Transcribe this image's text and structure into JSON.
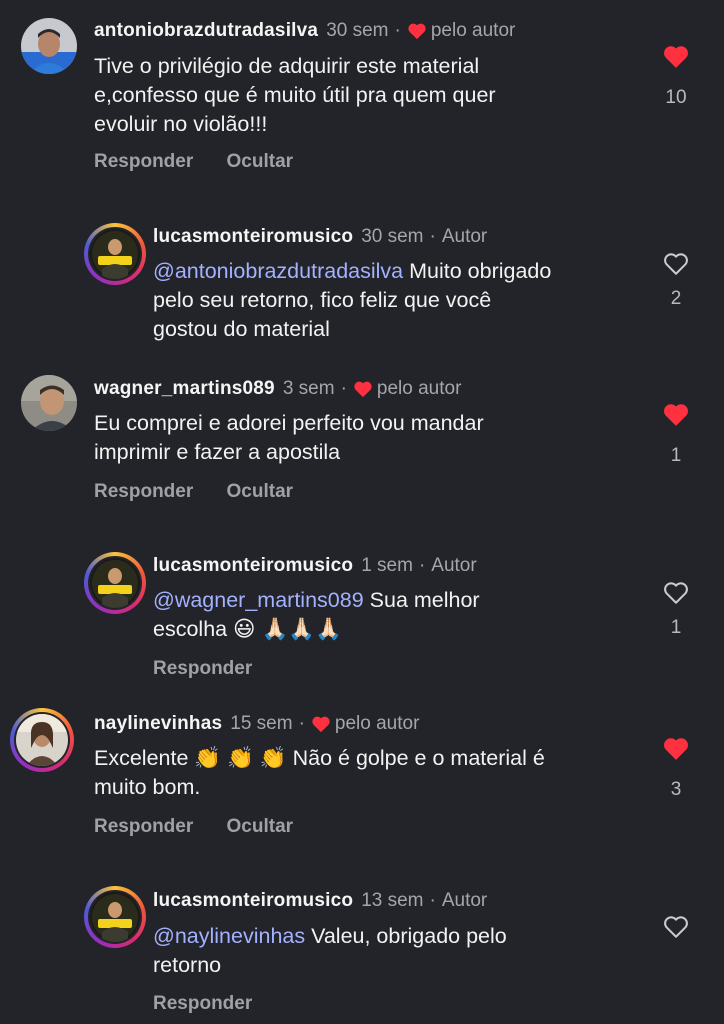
{
  "comments": [
    {
      "username": "antoniobrazdutradasilva",
      "time": "30 sem",
      "badge": "pelo autor",
      "text_lines": [
        "Tive o privilégio de adquirir este material",
        "e,confesso que é muito útil pra quem quer",
        "evoluir no violão!!!"
      ],
      "like_count": "10",
      "liked": true,
      "actions": [
        "Responder",
        "Ocultar"
      ]
    },
    {
      "username": "lucasmonteiromusico",
      "time": "30 sem",
      "badge": "Autor",
      "mention": "@antoniobrazdutradasilva",
      "text_lines": [
        "Muito obrigado",
        "pelo seu retorno, fico feliz que você",
        "gostou do material"
      ],
      "like_count": "2",
      "liked": false
    },
    {
      "username": "wagner_martins089",
      "time": "3 sem",
      "badge": "pelo autor",
      "text_lines": [
        "Eu comprei e adorei perfeito vou mandar",
        "imprimir e fazer a apostila"
      ],
      "like_count": "1",
      "liked": true,
      "actions": [
        "Responder",
        "Ocultar"
      ]
    },
    {
      "username": "lucasmonteiromusico",
      "time": "1 sem",
      "badge": "Autor",
      "mention": "@wagner_martins089",
      "text_lines": [
        "Sua melhor",
        "escolha 😃 🙏🏻🙏🏻🙏🏻"
      ],
      "like_count": "1",
      "liked": false,
      "actions": [
        "Responder"
      ]
    },
    {
      "username": "naylinevinhas",
      "time": "15 sem",
      "badge": "pelo autor",
      "text_lines": [
        "Excelente 👏 👏 👏  Não é golpe e o material é",
        "muito bom."
      ],
      "like_count": "3",
      "liked": true,
      "actions": [
        "Responder",
        "Ocultar"
      ]
    },
    {
      "username": "lucasmonteiromusico",
      "time": "13 sem",
      "badge": "Autor",
      "mention": "@naylinevinhas",
      "text_lines": [
        "Valeu, obrigado pelo",
        "retorno"
      ],
      "like_count": "",
      "liked": false,
      "actions": [
        "Responder"
      ]
    }
  ],
  "colors": {
    "background": "#232429",
    "heart": "#ff3040",
    "mention": "#a3b1ff",
    "muted": "#a3a6ad"
  },
  "icons": [
    "heart-filled-icon",
    "heart-outline-icon",
    "avatar-story-ring"
  ]
}
